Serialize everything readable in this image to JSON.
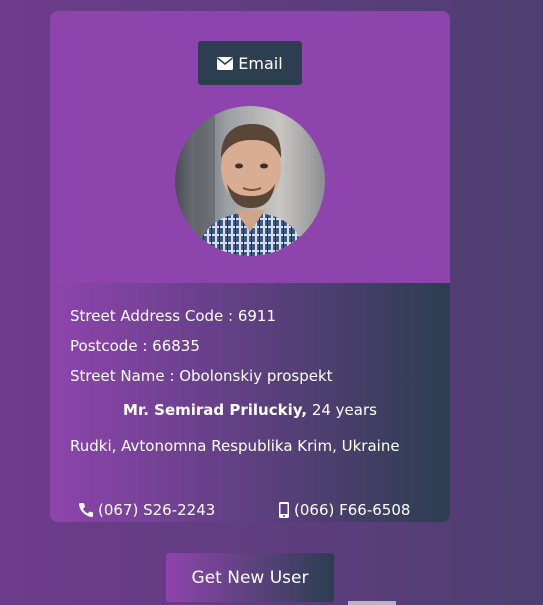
{
  "card": {
    "email_button": {
      "label": "Email",
      "icon": "envelope-icon"
    },
    "avatar_alt": "User portrait",
    "details": {
      "street_address_code": "Street Address Code : 6911",
      "postcode": "Postcode : 66835",
      "street_name": "Street Name : Obolonskiy prospekt"
    },
    "person": {
      "name": "Mr. Semirad Priluckiy,",
      "age": " 24 years"
    },
    "location": "Rudki, Avtonomna Respublika Krim, Ukraine",
    "phone": {
      "icon": "phone-icon",
      "value": "(067) S26-2243"
    },
    "cell": {
      "icon": "mobile-icon",
      "value": "(066) F66-6508"
    }
  },
  "actions": {
    "new_user_label": "Get New User"
  },
  "colors": {
    "card_top": "#8e44ad",
    "button_dark": "#2c3e50",
    "text": "#ffffff"
  }
}
